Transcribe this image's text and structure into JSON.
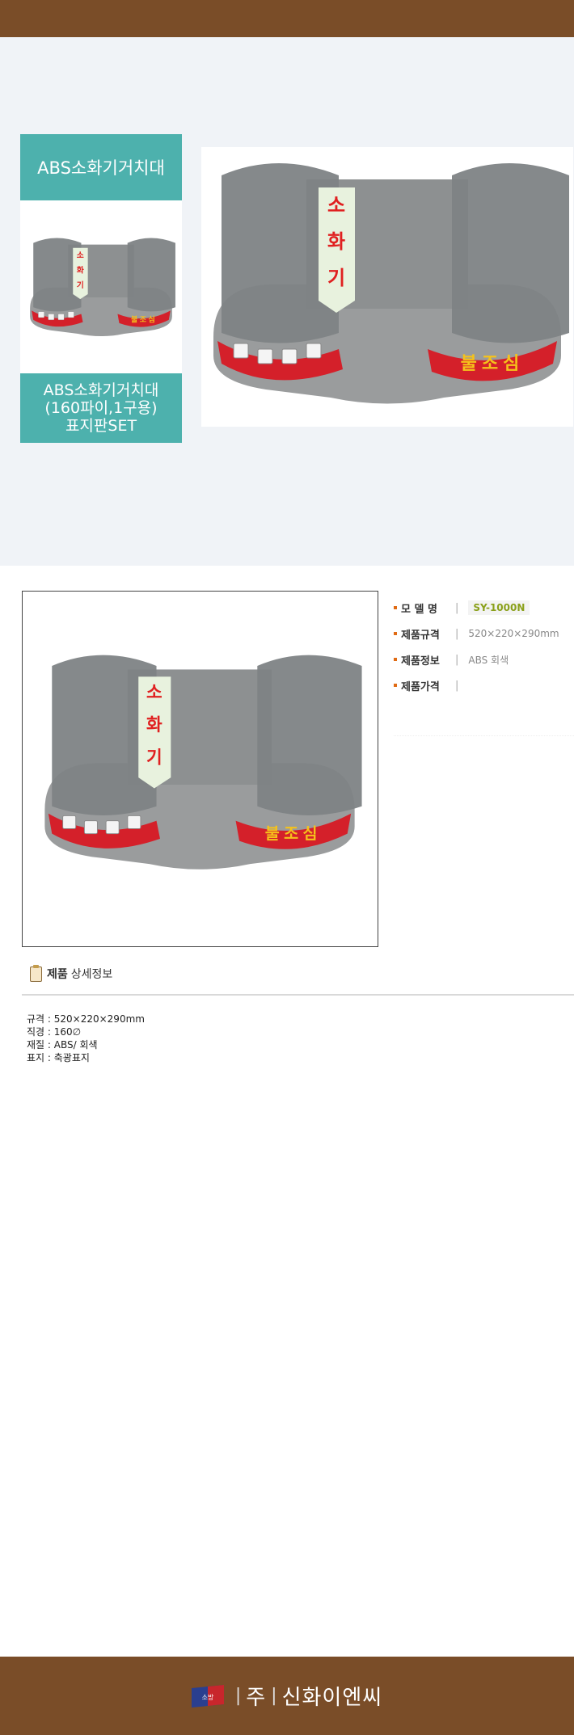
{
  "thumbnail": {
    "title": "ABS소화기거치대",
    "caption_line1": "ABS소화기거치대",
    "caption_line2": "(160파이,1구용)",
    "caption_line3": "표지판SET"
  },
  "product_sign": {
    "vertical_chars": [
      "소",
      "화",
      "기"
    ],
    "front_label": "불조심"
  },
  "specs": [
    {
      "label": "모 델 명",
      "value": "SY-1000N"
    },
    {
      "label": "제품규격",
      "value": "520×220×290mm"
    },
    {
      "label": "제품정보",
      "value": "ABS 회색"
    },
    {
      "label": "제품가격",
      "value": ""
    }
  ],
  "detail_section": {
    "title_bold": "제품",
    "title_rest": "상세정보",
    "items": [
      "규격 : 520×220×290mm",
      "직경 : 160∅",
      "재질 : ABS/ 회색",
      "표지 : 축광표지"
    ]
  },
  "footer": {
    "logo_prefix": "주",
    "logo_name": "신화이엔씨",
    "logo_mark": "소방"
  },
  "colors": {
    "header_brown": "#7a4d28",
    "teal": "#4db1ad",
    "accent_orange": "#e06b14",
    "model_green": "#8aa01a"
  }
}
